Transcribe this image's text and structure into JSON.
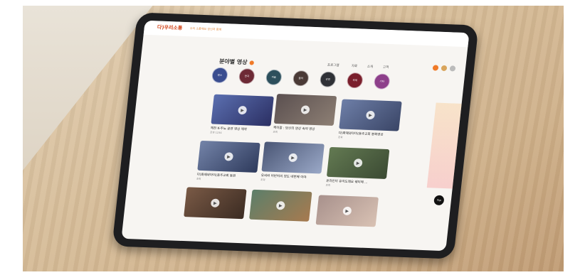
{
  "scene": {
    "logo": "다)우리소통",
    "logo_sub": "우리 소통해요 당신과 함께",
    "nav": [
      "프로그램",
      "자료",
      "소개",
      "고객"
    ],
    "heading": "분야별 영상",
    "categories": [
      {
        "label": "댄스",
        "color": "#3a4d8f"
      },
      {
        "label": "연극",
        "color": "#6d2a35"
      },
      {
        "label": "미술",
        "color": "#2d4f5c"
      },
      {
        "label": "음악",
        "color": "#4a3a36"
      },
      {
        "label": "강연",
        "color": "#2f3136"
      },
      {
        "label": "축제",
        "color": "#7a1f2c"
      },
      {
        "label": "기타",
        "color": "#8d3f8a"
      }
    ],
    "cards": [
      {
        "title": "제천 K-주뇨 공연 영상 제작",
        "sub": "조회 1234",
        "c1": "#5b6fb0",
        "c2": "#2b2f63"
      },
      {
        "title": "케이팝 : 당신의 영상 속의 영상",
        "sub": "조회",
        "c1": "#5b5050",
        "c2": "#8d7f74"
      },
      {
        "title": "다)화해와아이(동주교회 봉화영상",
        "sub": "조회",
        "c1": "#6e7fa8",
        "c2": "#3a4566"
      },
      {
        "title": "다)화해와아이(동주교회 동원",
        "sub": "조회",
        "c1": "#7383a8",
        "c2": "#2e3a5c"
      },
      {
        "title": "유씨와 어반치의 청도 네번째 이야",
        "sub": "조회",
        "c1": "#4a5675",
        "c2": "#9aa8c7"
      },
      {
        "title": "온라인이 유지도래요 웨이에 ...",
        "sub": "조회",
        "c1": "#637a52",
        "c2": "#3b4a33"
      },
      {
        "title": "",
        "sub": "",
        "c1": "#7a5a46",
        "c2": "#3b2b22"
      },
      {
        "title": "",
        "sub": "",
        "c1": "#5c7f6a",
        "c2": "#a77a4f"
      },
      {
        "title": "",
        "sub": "",
        "c1": "#a8918c",
        "c2": "#d9c2b4"
      }
    ],
    "fab": "Top"
  }
}
